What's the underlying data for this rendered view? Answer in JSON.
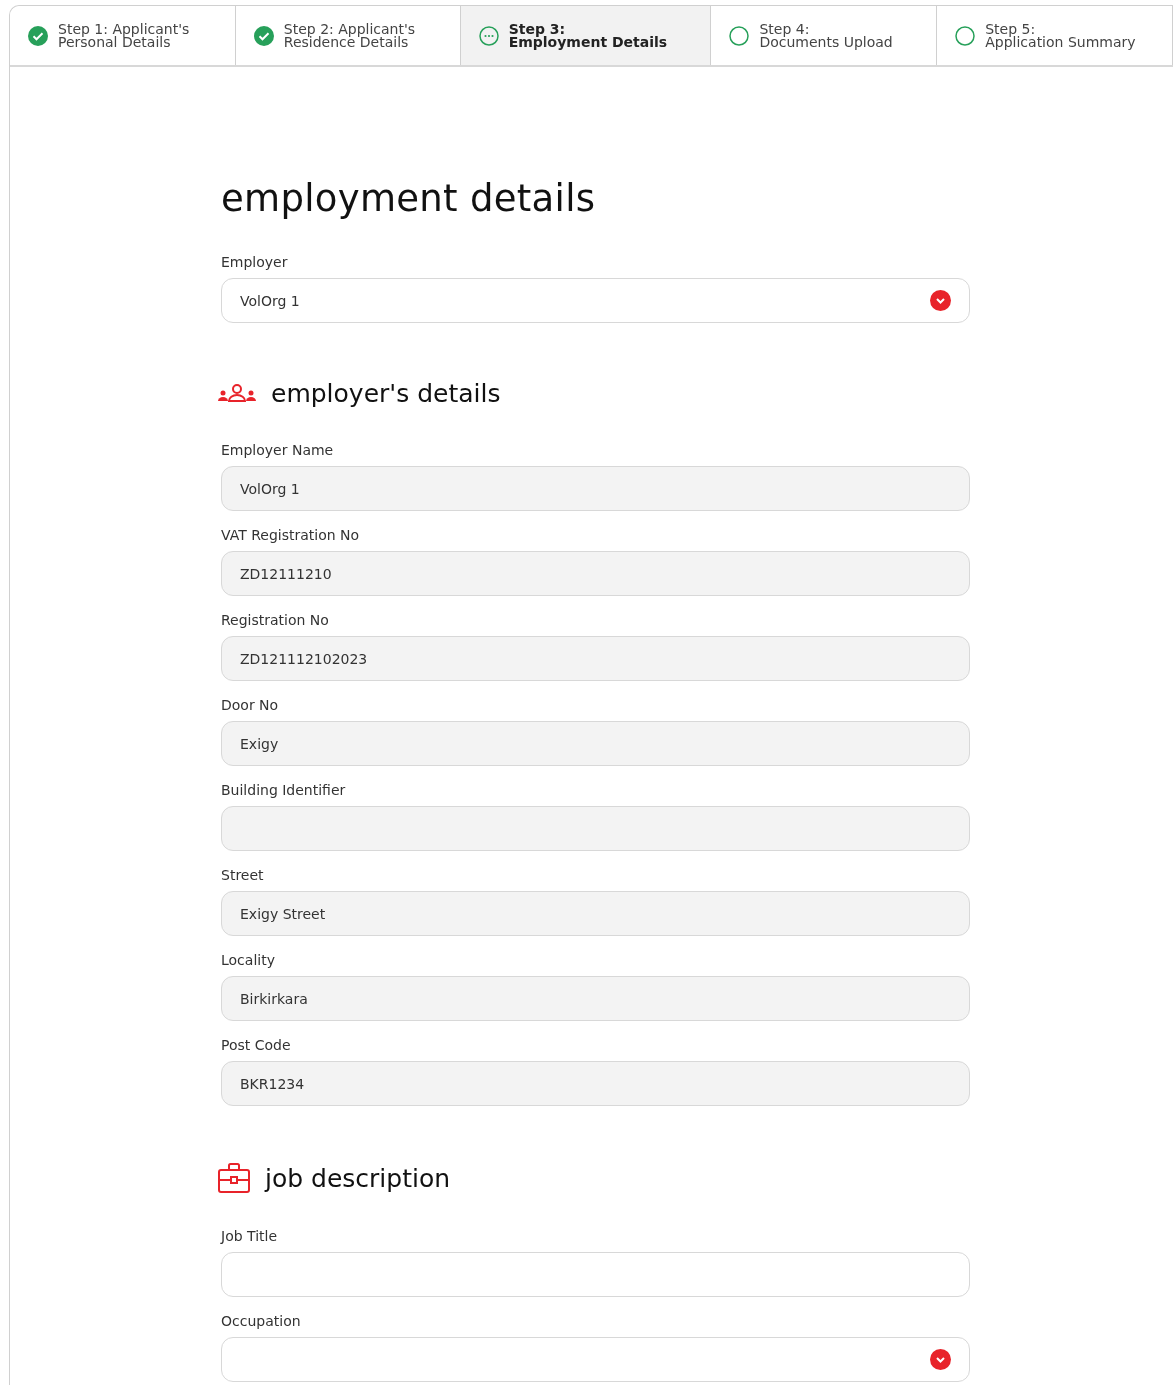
{
  "steps": [
    {
      "label": "Step 1: Applicant's",
      "sublabel": "Personal Details",
      "kind": "done",
      "selected": false
    },
    {
      "label": "Step 2: Applicant's",
      "sublabel": "Residence Details",
      "kind": "done",
      "selected": false
    },
    {
      "label": "Step 3:",
      "sublabel": "Employment Details",
      "kind": "current",
      "selected": true
    },
    {
      "label": "Step 4:",
      "sublabel": "Documents Upload",
      "kind": "todo",
      "selected": false
    },
    {
      "label": "Step 5:",
      "sublabel": "Application Summary",
      "kind": "todo",
      "selected": false
    }
  ],
  "title": "employment details",
  "employer": {
    "label": "Employer",
    "value": "VolOrg 1",
    "kind": "select"
  },
  "sections": [
    {
      "kind": "people",
      "title": "employer's details",
      "fields": [
        {
          "label": "Employer Name",
          "value": "VolOrg 1",
          "kind": "readonly"
        },
        {
          "label": "VAT Registration No",
          "value": "ZD12111210",
          "kind": "readonly"
        },
        {
          "label": "Registration No",
          "value": "ZD121112102023",
          "kind": "readonly"
        },
        {
          "label": "Door No",
          "value": "Exigy",
          "kind": "readonly"
        },
        {
          "label": "Building Identifier",
          "kind": "readonly"
        },
        {
          "label": "Street",
          "value": "Exigy Street",
          "kind": "readonly"
        },
        {
          "label": "Locality",
          "value": "Birkirkara",
          "kind": "readonly"
        },
        {
          "label": "Post Code",
          "value": "BKR1234",
          "kind": "readonly"
        }
      ]
    },
    {
      "kind": "briefcase",
      "title": "job description",
      "fields": [
        {
          "label": "Job Title",
          "kind": "text"
        },
        {
          "label": "Occupation",
          "kind": "select"
        }
      ]
    }
  ]
}
